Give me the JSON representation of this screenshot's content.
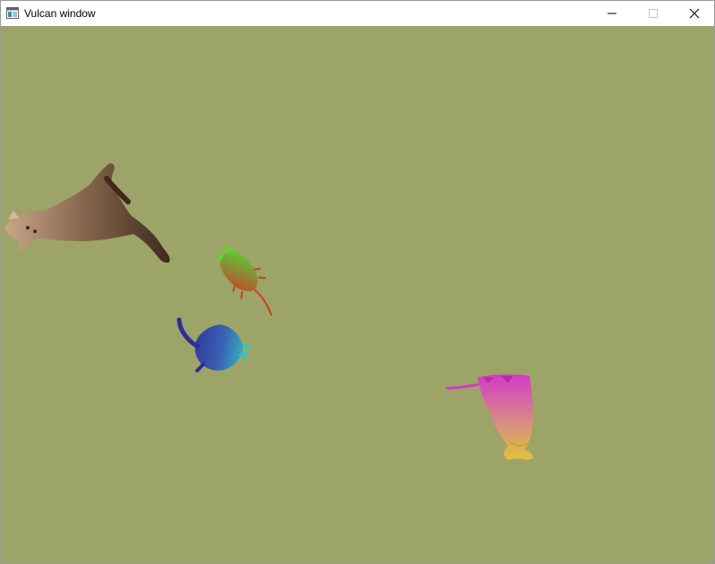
{
  "window": {
    "title": "Vulcan window",
    "icon": "window-app-icon",
    "controls": [
      "minimize-icon",
      "maximize-icon",
      "close-icon"
    ]
  },
  "scene": {
    "background_color": "#9ca567",
    "sprites": [
      {
        "name": "cat-sprite-brown",
        "tint": "brown",
        "colors": [
          "#c8a689",
          "#7a5a43",
          "#3f2a1c"
        ]
      },
      {
        "name": "cat-sprite-red-green",
        "tint": "red-green",
        "colors": [
          "#d43a1e",
          "#8b8a38",
          "#59d82c"
        ]
      },
      {
        "name": "cat-sprite-blue-cyan",
        "tint": "blue-cyan",
        "colors": [
          "#2e2e9a",
          "#3a62b4",
          "#33c4c4"
        ]
      },
      {
        "name": "cat-sprite-magenta-yellow",
        "tint": "magenta-yellow",
        "colors": [
          "#d43ac8",
          "#d88a86",
          "#e0c43c"
        ]
      }
    ]
  }
}
